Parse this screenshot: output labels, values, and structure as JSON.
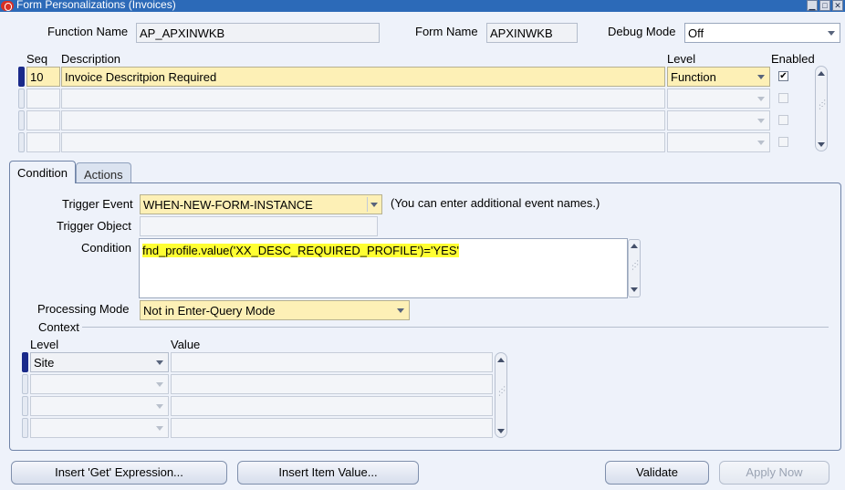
{
  "window": {
    "title": "Form Personalizations (Invoices)",
    "controls": {
      "minimize": "▁",
      "maximize": "□",
      "close": "✕"
    }
  },
  "header": {
    "function_name_label": "Function Name",
    "function_name_value": "AP_APXINWKB",
    "form_name_label": "Form Name",
    "form_name_value": "APXINWKB",
    "debug_mode_label": "Debug Mode",
    "debug_mode_value": "Off"
  },
  "rules_table": {
    "columns": {
      "seq": "Seq",
      "description": "Description",
      "level": "Level",
      "enabled": "Enabled"
    },
    "rows": [
      {
        "seq": "10",
        "description": "Invoice Descritpion Required",
        "level": "Function",
        "enabled": "✔"
      },
      {
        "seq": "",
        "description": "",
        "level": "",
        "enabled": ""
      },
      {
        "seq": "",
        "description": "",
        "level": "",
        "enabled": ""
      },
      {
        "seq": "",
        "description": "",
        "level": "",
        "enabled": ""
      }
    ]
  },
  "tabs": {
    "condition": "Condition",
    "actions": "Actions"
  },
  "condition": {
    "trigger_event_label": "Trigger Event",
    "trigger_event_value": "WHEN-NEW-FORM-INSTANCE",
    "trigger_event_hint": "(You can enter additional event names.)",
    "trigger_object_label": "Trigger Object",
    "trigger_object_value": "",
    "condition_label": "Condition",
    "condition_value": "fnd_profile.value('XX_DESC_REQUIRED_PROFILE')='YES'",
    "processing_mode_label": "Processing Mode",
    "processing_mode_value": "Not in Enter-Query Mode",
    "context_label": "Context",
    "context_columns": {
      "level": "Level",
      "value": "Value"
    },
    "context_rows": [
      {
        "level": "Site",
        "value": ""
      },
      {
        "level": "",
        "value": ""
      },
      {
        "level": "",
        "value": ""
      },
      {
        "level": "",
        "value": ""
      }
    ]
  },
  "buttons": {
    "insert_get_expression": "Insert 'Get' Expression...",
    "insert_item_value": "Insert Item Value...",
    "validate": "Validate",
    "apply_now": "Apply Now"
  },
  "colors": {
    "titlebar": "#2c6ab8",
    "current_record": "#fdf0b6",
    "highlight": "#ffff33",
    "background": "#eef2fa"
  }
}
